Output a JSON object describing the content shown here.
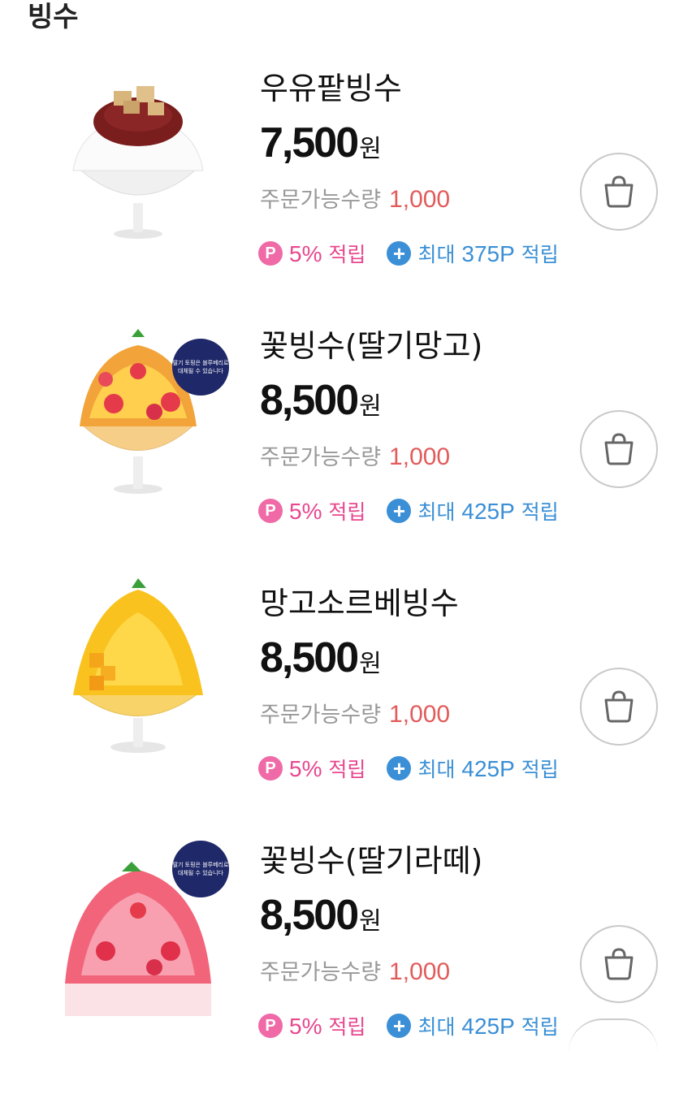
{
  "section": {
    "title": "빙수"
  },
  "currency_unit": "원",
  "qty_label": "주문가능수량",
  "point_badge": "P",
  "point_label": "적립",
  "plus_badge": "+",
  "max_prefix": "최대",
  "colors": {
    "point_pink": "#e8478f",
    "max_blue": "#3a8fd6",
    "qty_red": "#e25b5b",
    "topping_badge": "#1f2868"
  },
  "items": [
    {
      "name": "우유팥빙수",
      "price": "7,500",
      "qty": "1,000",
      "rate": "5%",
      "max_point": "375P",
      "topping_note": ""
    },
    {
      "name": "꽃빙수(딸기망고)",
      "price": "8,500",
      "qty": "1,000",
      "rate": "5%",
      "max_point": "425P",
      "topping_note": "딸기 토핑은 블루베리로 대체될 수 있습니다"
    },
    {
      "name": "망고소르베빙수",
      "price": "8,500",
      "qty": "1,000",
      "rate": "5%",
      "max_point": "425P",
      "topping_note": ""
    },
    {
      "name": "꽃빙수(딸기라떼)",
      "price": "8,500",
      "qty": "1,000",
      "rate": "5%",
      "max_point": "425P",
      "topping_note": "딸기 토핑은 블루베리로 대체될 수 있습니다"
    }
  ]
}
